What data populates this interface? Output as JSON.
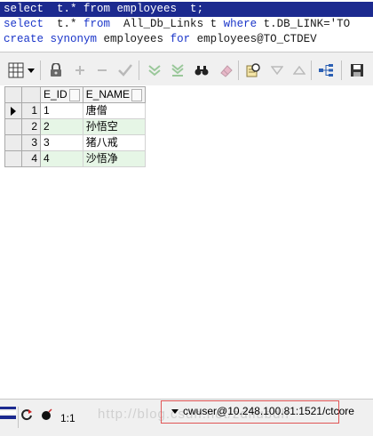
{
  "editor": {
    "line1": {
      "kw1": "select",
      "t1": "  t.* ",
      "kw2": "from",
      "t2": " employees  t;"
    },
    "line2": {
      "kw1": "select",
      "t1": "  t.* ",
      "kw2": "from",
      "t2": "  All_Db_Links t ",
      "kw3": "where",
      "t3": " t.DB_LINK='TO"
    },
    "line3": {
      "kw1": "create",
      "t1": " ",
      "kw2": "synonym",
      "t2": " employees ",
      "kw3": "for",
      "t3": " employees@TO_CTDEV"
    }
  },
  "toolbar": {
    "icons": [
      "grid-icon",
      "dropdown-arrow-icon",
      "lock-icon",
      "add-record-icon",
      "delete-record-icon",
      "post-changes-icon",
      "fetch-next-icon",
      "fetch-last-icon",
      "find-icon",
      "clear-icon",
      "query-by-example-icon",
      "filter-icon",
      "sort-icon",
      "tree-icon",
      "save-icon"
    ]
  },
  "grid": {
    "columns": [
      "E_ID",
      "E_NAME"
    ],
    "rows": [
      {
        "num": "1",
        "e_id": "1",
        "e_name": "唐僧"
      },
      {
        "num": "2",
        "e_id": "2",
        "e_name": "孙悟空"
      },
      {
        "num": "3",
        "e_id": "3",
        "e_name": "猪八戒"
      },
      {
        "num": "4",
        "e_id": "4",
        "e_name": "沙悟净"
      }
    ]
  },
  "statusbar": {
    "position": "1:1",
    "connection": "cwuser@10.248.100.81:1521/ctcore",
    "watermark": "http://blog.csdn.net/zdliubdh"
  },
  "colors": {
    "selection": "#1c2a8f",
    "keyword": "#1a35c9",
    "even_row": "#e6f6e6",
    "highlight_box": "#e05555"
  }
}
